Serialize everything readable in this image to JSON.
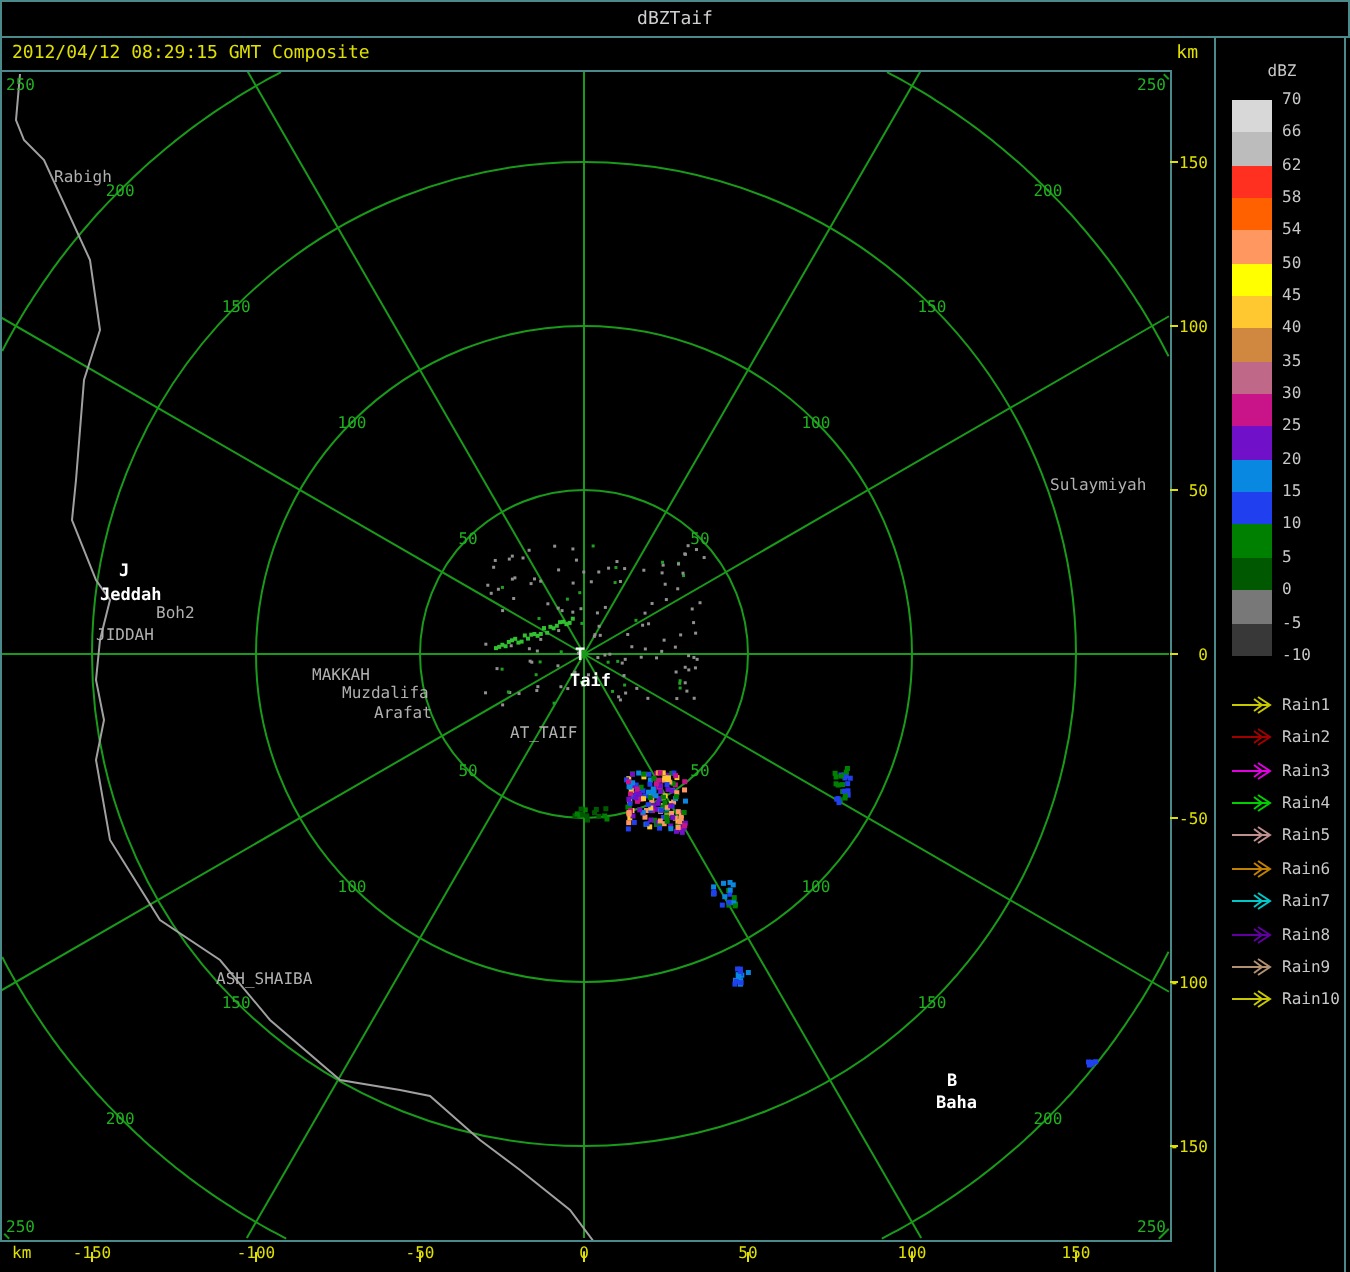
{
  "window": {
    "title": "dBZTaif"
  },
  "header": {
    "timestamp": "2012/04/12 08:29:15 GMT Composite",
    "unit": "km"
  },
  "map": {
    "ring_labels": [
      [
        "50",
        "50",
        "50",
        "50"
      ],
      [
        "100",
        "100",
        "100",
        "100"
      ],
      [
        "150",
        "150",
        "150",
        "150"
      ],
      [
        "200",
        "200",
        "200",
        "200"
      ],
      [
        "250",
        "250",
        "250",
        "250"
      ]
    ],
    "places": [
      {
        "name": "Rabigh",
        "kind": "place"
      },
      {
        "name": "J",
        "kind": "radar"
      },
      {
        "name": "Jeddah",
        "kind": "city"
      },
      {
        "name": "Boh2",
        "kind": "place"
      },
      {
        "name": "JIDDAH",
        "kind": "place"
      },
      {
        "name": "MAKKAH",
        "kind": "place"
      },
      {
        "name": "Muzdalifa",
        "kind": "place"
      },
      {
        "name": "Arafat",
        "kind": "place"
      },
      {
        "name": "AT_TAIF",
        "kind": "place"
      },
      {
        "name": "T",
        "kind": "radar"
      },
      {
        "name": "Taif",
        "kind": "city"
      },
      {
        "name": "Sulaymiyah",
        "kind": "place"
      },
      {
        "name": "ASH_SHAIBA",
        "kind": "place"
      },
      {
        "name": "B",
        "kind": "radar"
      },
      {
        "name": "Baha",
        "kind": "city"
      }
    ]
  },
  "y_axis": {
    "ticks": [
      "150",
      "100",
      "50",
      "0",
      "-50",
      "-100",
      "-150"
    ]
  },
  "x_axis": {
    "unit": "km",
    "ticks": [
      "-150",
      "-100",
      "-50",
      "0",
      "50",
      "100",
      "150"
    ]
  },
  "legend": {
    "title": "dBZ",
    "scale_labels": [
      "70",
      "66",
      "62",
      "58",
      "54",
      "50",
      "45",
      "40",
      "35",
      "30",
      "25",
      "20",
      "15",
      "10",
      "5",
      "0",
      "-5",
      "-10"
    ],
    "bands": [
      {
        "color": "#d8d8d8"
      },
      {
        "color": "#bcbcbc"
      },
      {
        "color": "#ff3020"
      },
      {
        "color": "#ff6000"
      },
      {
        "color": "#ff9860"
      },
      {
        "color": "#ffff00"
      },
      {
        "color": "#ffc830"
      },
      {
        "color": "#d08840"
      },
      {
        "color": "#c06888"
      },
      {
        "color": "#c81488"
      },
      {
        "color": "#7010c8"
      },
      {
        "color": "#0888e0"
      },
      {
        "color": "#2040f0"
      },
      {
        "color": "#008000"
      },
      {
        "color": "#005800"
      },
      {
        "color": "#787878"
      },
      {
        "color": "#383838"
      }
    ],
    "tracks": [
      {
        "label": "Rain1",
        "color": "#c8c800"
      },
      {
        "label": "Rain2",
        "color": "#a00000"
      },
      {
        "label": "Rain3",
        "color": "#e000e0"
      },
      {
        "label": "Rain4",
        "color": "#00d000"
      },
      {
        "label": "Rain5",
        "color": "#c09090"
      },
      {
        "label": "Rain6",
        "color": "#c08000"
      },
      {
        "label": "Rain7",
        "color": "#00c8c8"
      },
      {
        "label": "Rain8",
        "color": "#6000a0"
      },
      {
        "label": "Rain9",
        "color": "#b09070"
      },
      {
        "label": "Rain10",
        "color": "#c8c800"
      }
    ]
  }
}
